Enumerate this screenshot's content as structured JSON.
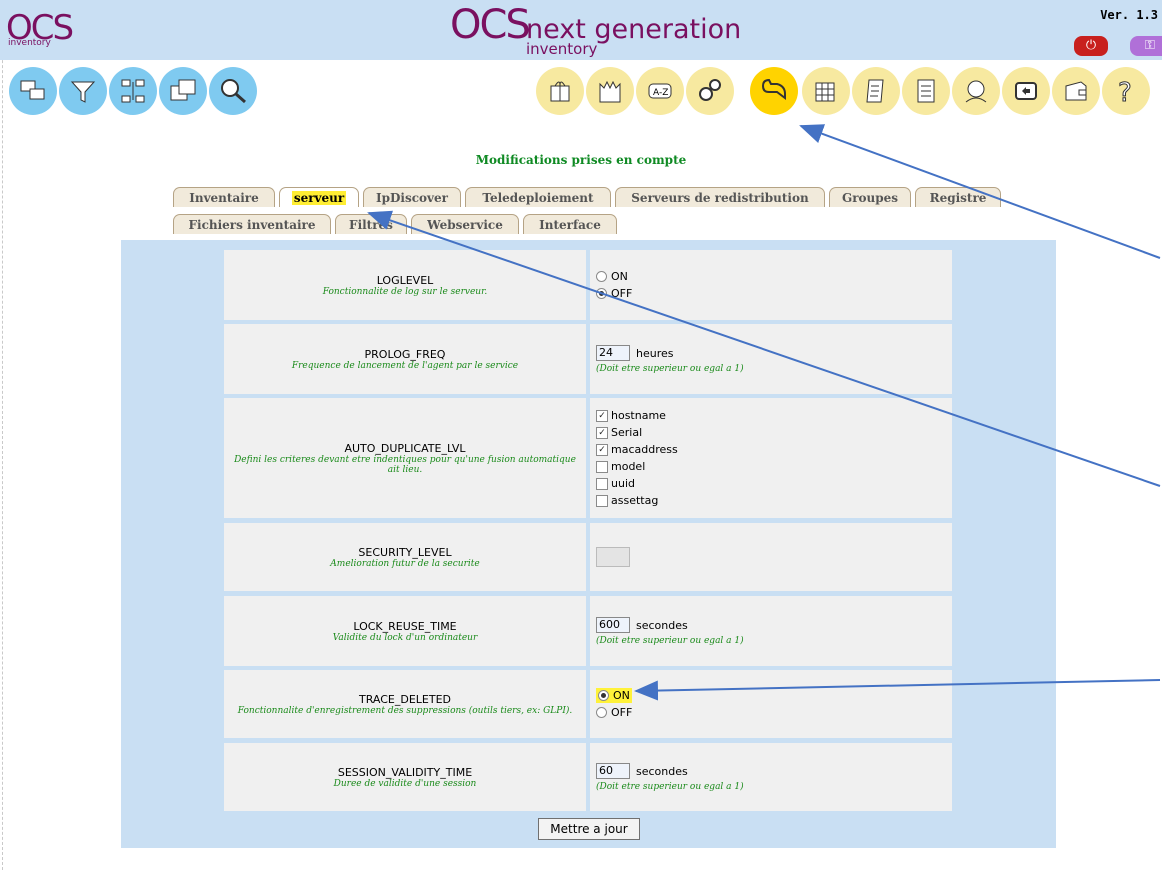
{
  "header": {
    "logo_text": "OCS",
    "logo_sub": "inventory",
    "title_main": "OCS",
    "title_next": "next generation",
    "title_sub": "inventory",
    "version": "Ver. 1.3",
    "power_icon": "power-icon",
    "key_icon": "key-icon"
  },
  "nav_left": [
    "computers-icon",
    "filter-icon",
    "network-icon",
    "windows-icon",
    "search-icon"
  ],
  "nav_right": [
    "gift-icon",
    "castle-icon",
    "dictionary-icon",
    "gears-icon",
    "wrench-icon",
    "grid-icon",
    "document-icon",
    "report-icon",
    "admin-icon",
    "restore-icon",
    "wallet-icon",
    "help-icon"
  ],
  "message": "Modifications prises en compte",
  "tabs_row1": [
    "Inventaire",
    "serveur",
    "IpDiscover",
    "Teledeploiement",
    "Serveurs de redistribution",
    "Groupes",
    "Registre"
  ],
  "tabs_row2": [
    "Fichiers inventaire",
    "Filtres",
    "Webservice",
    "Interface"
  ],
  "params": {
    "loglevel": {
      "name": "LOGLEVEL",
      "desc": "Fonctionnalite de log sur le serveur.",
      "opt_on": "ON",
      "opt_off": "OFF",
      "selected": "OFF"
    },
    "prolog": {
      "name": "PROLOG_FREQ",
      "desc": "Frequence de lancement de l'agent par le service",
      "value": "24",
      "unit": "heures",
      "hint": "(Doit etre superieur ou egal a 1)"
    },
    "autodup": {
      "name": "AUTO_DUPLICATE_LVL",
      "desc": "Defini les criteres devant etre indentiques pour qu'une fusion automatique ait lieu.",
      "options": [
        {
          "label": "hostname",
          "checked": true
        },
        {
          "label": "Serial",
          "checked": true
        },
        {
          "label": "macaddress",
          "checked": true
        },
        {
          "label": "model",
          "checked": false
        },
        {
          "label": "uuid",
          "checked": false
        },
        {
          "label": "assettag",
          "checked": false
        }
      ]
    },
    "security": {
      "name": "SECURITY_LEVEL",
      "desc": "Amelioration futur de la securite",
      "value": ""
    },
    "lockreuse": {
      "name": "LOCK_REUSE_TIME",
      "desc": "Validite du lock d'un ordinateur",
      "value": "600",
      "unit": "secondes",
      "hint": "(Doit etre superieur ou egal a 1)"
    },
    "trace": {
      "name": "TRACE_DELETED",
      "desc": "Fonctionnalite d'enregistrement des suppressions (outils tiers, ex: GLPI).",
      "opt_on": "ON",
      "opt_off": "OFF",
      "selected": "ON"
    },
    "session": {
      "name": "SESSION_VALIDITY_TIME",
      "desc": "Duree de validite d'une session",
      "value": "60",
      "unit": "secondes",
      "hint": "(Doit etre superieur ou egal a 1)"
    }
  },
  "submit_label": "Mettre a jour",
  "colors": {
    "accent": "#7a1060",
    "panel": "#c9dff3",
    "highlight": "#fff23a",
    "arrow": "#4472c4"
  }
}
